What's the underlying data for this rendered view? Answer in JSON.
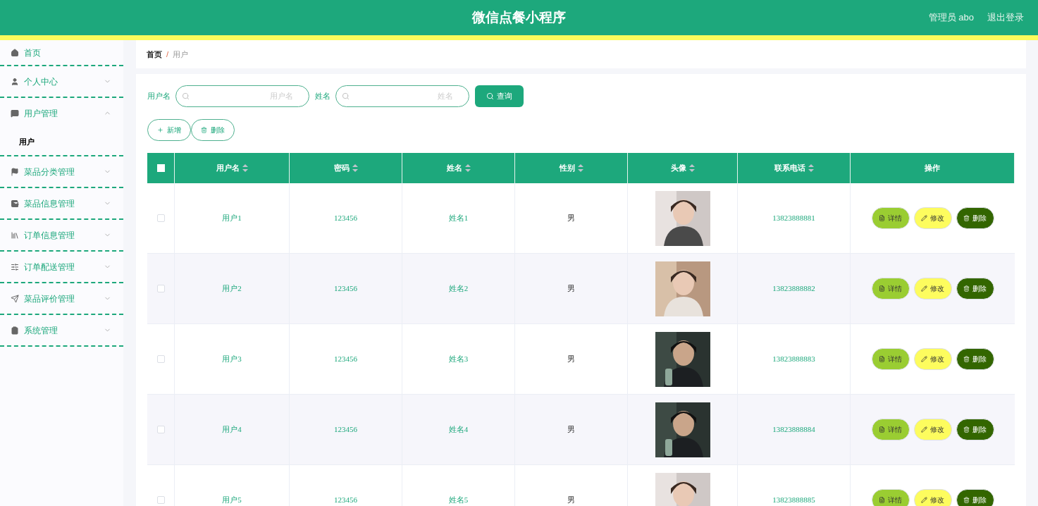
{
  "header": {
    "title": "微信点餐小程序",
    "user": "管理员 abo",
    "logout": "退出登录"
  },
  "sidebar": {
    "items": [
      {
        "label": "首页",
        "kind": "link"
      },
      {
        "label": "个人中心",
        "kind": "submenu",
        "expanded": false
      },
      {
        "label": "用户管理",
        "kind": "submenu",
        "expanded": true,
        "children": [
          {
            "label": "用户",
            "selected": true
          }
        ]
      },
      {
        "label": "菜品分类管理",
        "kind": "submenu",
        "expanded": false
      },
      {
        "label": "菜品信息管理",
        "kind": "submenu",
        "expanded": false
      },
      {
        "label": "订单信息管理",
        "kind": "submenu",
        "expanded": false
      },
      {
        "label": "订单配送管理",
        "kind": "submenu",
        "expanded": false
      },
      {
        "label": "菜品评价管理",
        "kind": "submenu",
        "expanded": false
      },
      {
        "label": "系统管理",
        "kind": "submenu",
        "expanded": false
      }
    ]
  },
  "breadcrumb": [
    "首页",
    "用户"
  ],
  "breadcrumb_separator": "/",
  "search": {
    "fields": [
      {
        "label": "用户名",
        "placeholder": "用户名"
      },
      {
        "label": "姓名",
        "placeholder": "姓名"
      }
    ],
    "button": "查询"
  },
  "actions": [
    {
      "label": "新增",
      "kind": "add"
    },
    {
      "label": "删除",
      "kind": "delete"
    }
  ],
  "table": {
    "columns": [
      {
        "label": "用户名",
        "sortable": true
      },
      {
        "label": "密码",
        "sortable": true
      },
      {
        "label": "姓名",
        "sortable": true
      },
      {
        "label": "性别",
        "sortable": true
      },
      {
        "label": "头像",
        "sortable": true
      },
      {
        "label": "联系电话",
        "sortable": true
      },
      {
        "label": "操作",
        "sortable": false
      }
    ],
    "select_all_checked": false,
    "rows": [
      {
        "checked": false,
        "username": "用户1",
        "password": "123456",
        "name": "姓名1",
        "gender": "男",
        "phone": "13823888881",
        "buttons": [
          {
            "label": "详情",
            "kind": "detail"
          },
          {
            "label": "修改",
            "kind": "edit"
          },
          {
            "label": "删除",
            "kind": "delete"
          }
        ]
      },
      {
        "checked": false,
        "username": "用户2",
        "password": "123456",
        "name": "姓名2",
        "gender": "男",
        "phone": "13823888882",
        "buttons": [
          {
            "label": "详情",
            "kind": "detail"
          },
          {
            "label": "修改",
            "kind": "edit"
          },
          {
            "label": "删除",
            "kind": "delete"
          }
        ]
      },
      {
        "checked": false,
        "username": "用户3",
        "password": "123456",
        "name": "姓名3",
        "gender": "男",
        "phone": "13823888883",
        "buttons": [
          {
            "label": "详情",
            "kind": "detail"
          },
          {
            "label": "修改",
            "kind": "edit"
          },
          {
            "label": "删除",
            "kind": "delete"
          }
        ]
      },
      {
        "checked": false,
        "username": "用户4",
        "password": "123456",
        "name": "姓名4",
        "gender": "男",
        "phone": "13823888884",
        "buttons": [
          {
            "label": "详情",
            "kind": "detail"
          },
          {
            "label": "修改",
            "kind": "edit"
          },
          {
            "label": "删除",
            "kind": "delete"
          }
        ]
      },
      {
        "checked": false,
        "username": "用户5",
        "password": "123456",
        "name": "姓名5",
        "gender": "男",
        "phone": "13823888885",
        "buttons": [
          {
            "label": "详情",
            "kind": "detail"
          },
          {
            "label": "修改",
            "kind": "edit"
          },
          {
            "label": "删除",
            "kind": "delete"
          }
        ]
      }
    ]
  }
}
